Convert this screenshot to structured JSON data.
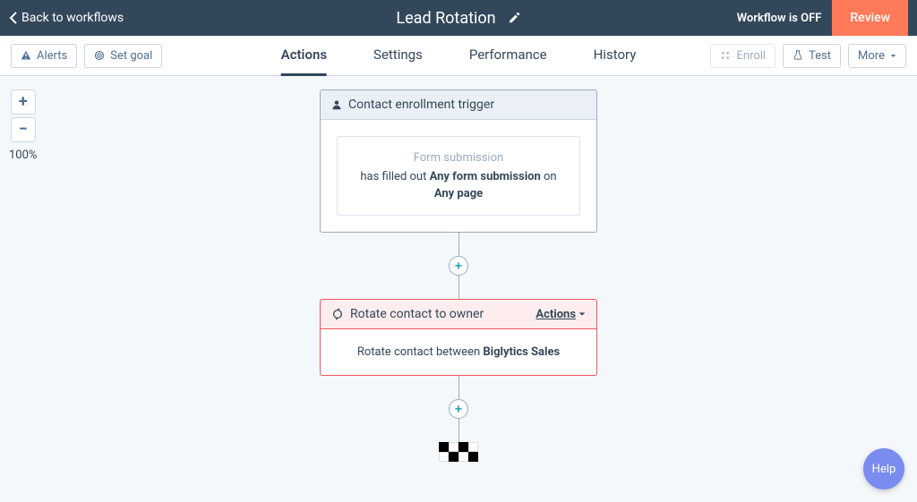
{
  "header": {
    "back_label": "Back to workflows",
    "title": "Lead Rotation",
    "status_label": "Workflow is OFF",
    "review_label": "Review"
  },
  "toolbar": {
    "alerts_label": "Alerts",
    "set_goal_label": "Set goal",
    "enroll_label": "Enroll",
    "test_label": "Test",
    "more_label": "More"
  },
  "tabs": {
    "actions": "Actions",
    "settings": "Settings",
    "performance": "Performance",
    "history": "History"
  },
  "zoom": {
    "plus": "+",
    "minus": "−",
    "level": "100%"
  },
  "trigger_card": {
    "header": "Contact enrollment trigger",
    "subtitle": "Form submission",
    "line_pre": "has filled out ",
    "line_bold1": "Any form submission",
    "line_mid": " on",
    "line_bold2": "Any page"
  },
  "rotate_card": {
    "header": "Rotate contact to owner",
    "actions_label": "Actions",
    "body_pre": "Rotate contact between ",
    "body_bold": "Biglytics Sales"
  },
  "add_button": "+",
  "help_label": "Help"
}
